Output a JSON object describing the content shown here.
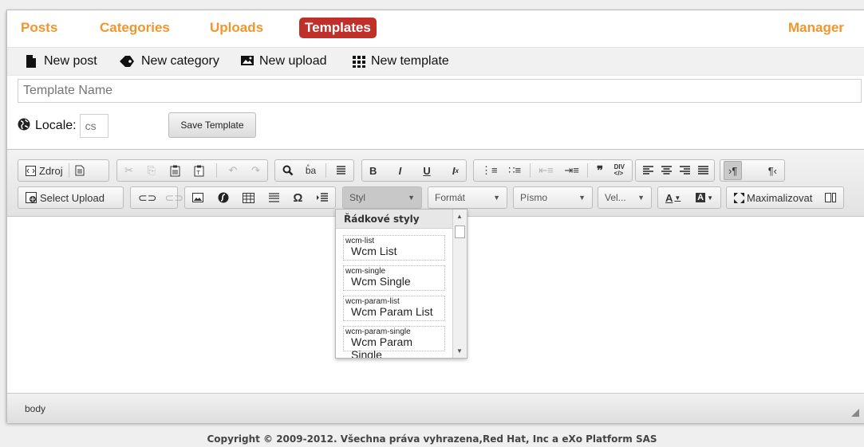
{
  "nav": {
    "posts": "Posts",
    "categories": "Categories",
    "uploads": "Uploads",
    "templates": "Templates",
    "manager": "Manager",
    "accent": "#f0962e",
    "active_bg": "#c0302b"
  },
  "newbar": {
    "new_post": "New post",
    "new_category": "New category",
    "new_upload": "New upload",
    "new_template": "New template"
  },
  "form": {
    "template_name_placeholder": "Template Name",
    "locale_label": "Locale:",
    "locale_value": "cs",
    "save_label": "Save Template"
  },
  "toolbar": {
    "source_label": "Zdroj",
    "select_upload_label": "Select Upload",
    "styl": "Styl",
    "format": "Formát",
    "font": "Písmo",
    "size": "Vel...",
    "maximize_label": "Maximalizovat"
  },
  "style_dropdown": {
    "header": "Řádkové styly",
    "items": [
      {
        "key": "wcm-list",
        "label": "Wcm List"
      },
      {
        "key": "wcm-single",
        "label": "Wcm Single"
      },
      {
        "key": "wcm-param-list",
        "label": "Wcm Param List"
      },
      {
        "key": "wcm-param-single",
        "label": "Wcm Param Single"
      }
    ]
  },
  "statusbar": {
    "path": "body"
  },
  "footer": {
    "copyright": "Copyright © 2009-2012. Všechna práva vyhrazena,Red Hat, Inc a eXo Platform SAS"
  }
}
